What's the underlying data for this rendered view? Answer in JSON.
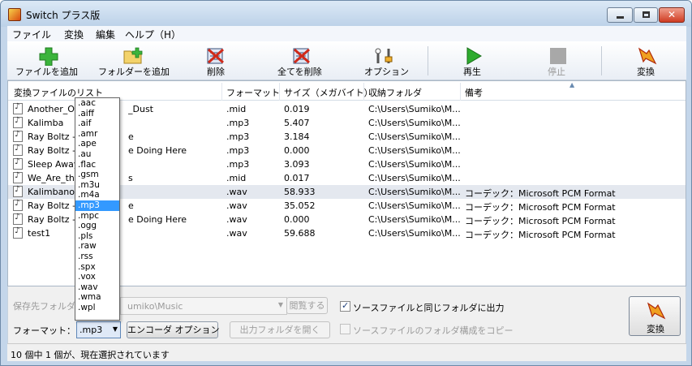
{
  "window": {
    "title": "Switch プラス版"
  },
  "menu": [
    "ファイル",
    "変換",
    "編集",
    "ヘルプ（H）"
  ],
  "toolbar": {
    "add_file": "ファイルを追加",
    "add_folder": "フォルダーを追加",
    "delete": "削除",
    "delete_all": "全てを削除",
    "options": "オプション",
    "play": "再生",
    "stop": "停止",
    "convert": "変換"
  },
  "list": {
    "columns": [
      "変換ファイルのリスト",
      "フォーマット",
      "サイズ（メガバイト）",
      "収納フォルダ",
      "備考"
    ],
    "rows": [
      {
        "name": "Another_One",
        "name_tail": "_Dust",
        "format": ".mid",
        "size": "0.019",
        "folder": "C:\\Users\\Sumiko\\M...",
        "note": ""
      },
      {
        "name": "Kalimba",
        "name_tail": "",
        "format": ".mp3",
        "size": "5.407",
        "folder": "C:\\Users\\Sumiko\\M...",
        "note": ""
      },
      {
        "name": "Ray Boltz - S",
        "name_tail": "e",
        "format": ".mp3",
        "size": "3.184",
        "folder": "C:\\Users\\Sumiko\\M...",
        "note": ""
      },
      {
        "name": "Ray Boltz - W",
        "name_tail": "e Doing Here",
        "format": ".mp3",
        "size": "0.000",
        "folder": "C:\\Users\\Sumiko\\M...",
        "note": ""
      },
      {
        "name": "Sleep Away",
        "name_tail": "",
        "format": ".mp3",
        "size": "3.093",
        "folder": "C:\\Users\\Sumiko\\M...",
        "note": ""
      },
      {
        "name": "We_Are_the_",
        "name_tail": "s",
        "format": ".mid",
        "size": "0.017",
        "folder": "C:\\Users\\Sumiko\\M...",
        "note": ""
      },
      {
        "name": "Kalimbanotes",
        "name_tail": "",
        "format": ".wav",
        "size": "58.933",
        "folder": "C:\\Users\\Sumiko\\M...",
        "note": "コーデック：Microsoft PCM Format",
        "selected": true
      },
      {
        "name": "Ray Boltz - S",
        "name_tail": "e",
        "format": ".wav",
        "size": "35.052",
        "folder": "C:\\Users\\Sumiko\\M...",
        "note": "コーデック：Microsoft PCM Format"
      },
      {
        "name": "Ray Boltz - W",
        "name_tail": "e Doing Here",
        "format": ".wav",
        "size": "0.000",
        "folder": "C:\\Users\\Sumiko\\M...",
        "note": "コーデック：Microsoft PCM Format"
      },
      {
        "name": "test1",
        "name_tail": "",
        "format": ".wav",
        "size": "59.688",
        "folder": "C:\\Users\\Sumiko\\M...",
        "note": "コーデック：Microsoft PCM Format"
      }
    ]
  },
  "bottom": {
    "save_folder_label": "保存先フォルダ：",
    "save_folder_value": "umiko\\Music",
    "browse": "閲覧する",
    "same_folder_label": "ソースファイルと同じフォルダに出力",
    "same_folder_checked": true,
    "format_label": "フォーマット：",
    "format_value": ".mp3",
    "encoder_options": "エンコーダ オプション",
    "open_output": "出力フォルダを開く",
    "copy_structure_label": "ソースファイルのフォルダ構成をコピー",
    "copy_structure_checked": false,
    "convert": "変換"
  },
  "format_options": [
    ".aac",
    ".aiff",
    ".aif",
    ".amr",
    ".ape",
    ".au",
    ".flac",
    ".gsm",
    ".m3u",
    ".m4a",
    ".mp3",
    ".mpc",
    ".ogg",
    ".pls",
    ".raw",
    ".rss",
    ".spx",
    ".vox",
    ".wav",
    ".wma",
    ".wpl"
  ],
  "selected_format_index": 10,
  "status": "10 個中 1 個が、現在選択されています",
  "colors": {
    "title_bar": "#c4d6ea",
    "selection": "#3399ff",
    "play_green": "#2eab2e",
    "add_green": "#3cb43c"
  }
}
